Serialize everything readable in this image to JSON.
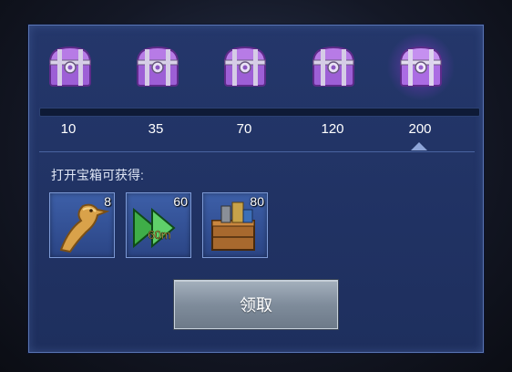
{
  "colors": {
    "panel_bg": "#22366a",
    "panel_border": "#5a76b4",
    "chest_purple": "#a85fe0",
    "progress_track": "#0e1a36",
    "button_gray": "#8b98a7",
    "marker": "#8fa6d8"
  },
  "progress": {
    "value": 0,
    "thresholds": [
      "10",
      "35",
      "70",
      "120",
      "200"
    ],
    "selected_index": 4
  },
  "chests": [
    {
      "icon": "purple-treasure-chest-icon",
      "highlighted": false
    },
    {
      "icon": "purple-treasure-chest-icon",
      "highlighted": false
    },
    {
      "icon": "purple-treasure-chest-icon",
      "highlighted": false
    },
    {
      "icon": "purple-treasure-chest-icon",
      "highlighted": false
    },
    {
      "icon": "purple-treasure-chest-icon",
      "highlighted": true
    }
  ],
  "rewards": {
    "title": "打开宝箱可获得:",
    "items": [
      {
        "icon": "golden-eagle-icon",
        "count": "8"
      },
      {
        "icon": "speedup-arrows-icon",
        "count": "60",
        "label": "60m"
      },
      {
        "icon": "resource-crate-icon",
        "count": "80"
      }
    ]
  },
  "claim_button": {
    "label": "领取"
  }
}
